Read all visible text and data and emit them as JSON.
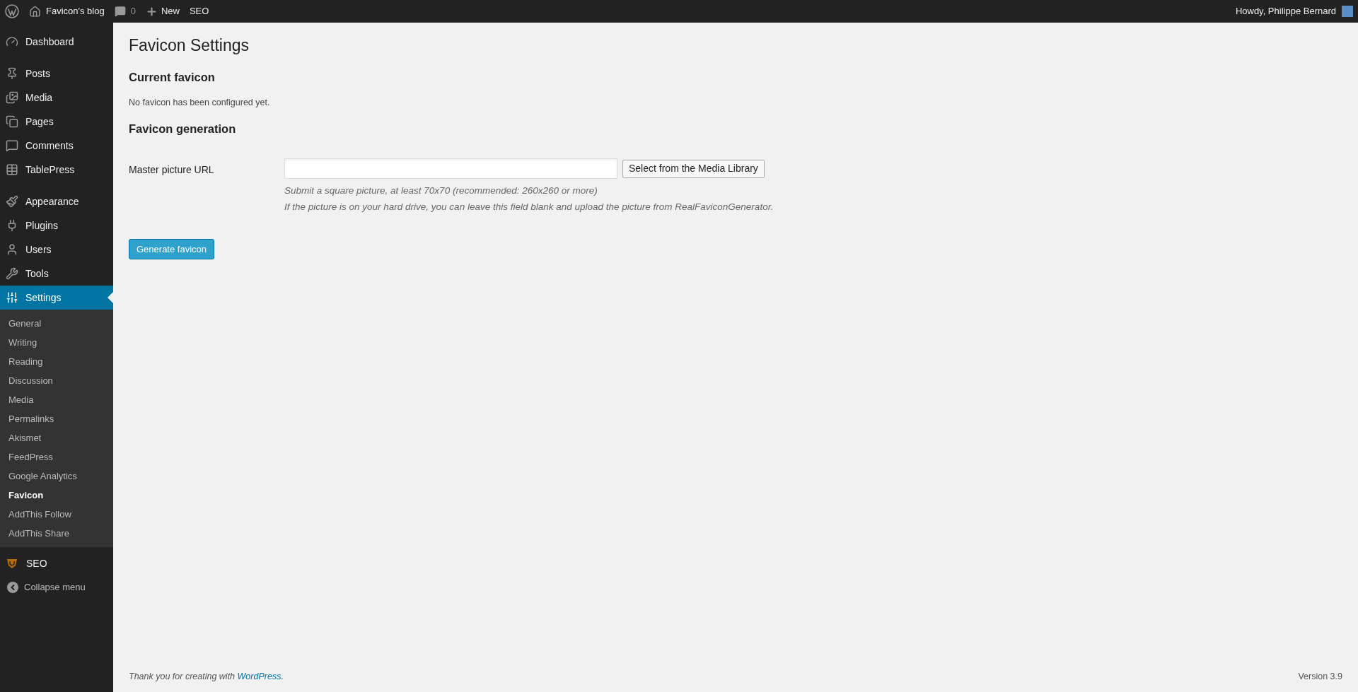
{
  "admin_bar": {
    "site": "Favicon's blog",
    "comments": "0",
    "new": "New",
    "seo": "SEO",
    "greeting": "Howdy, Philippe Bernard"
  },
  "sidebar": {
    "groups": [
      [
        {
          "label": "Dashboard",
          "selected": false
        }
      ],
      [
        {
          "label": "Posts",
          "selected": false
        },
        {
          "label": "Media",
          "selected": false
        },
        {
          "label": "Pages",
          "selected": false
        },
        {
          "label": "Comments",
          "selected": false
        },
        {
          "label": "TablePress",
          "selected": false
        }
      ],
      [
        {
          "label": "Appearance",
          "selected": false
        },
        {
          "label": "Plugins",
          "selected": false
        },
        {
          "label": "Users",
          "selected": false
        },
        {
          "label": "Tools",
          "selected": false
        },
        {
          "label": "Settings",
          "selected": true,
          "children": [
            {
              "label": "General",
              "selected": false
            },
            {
              "label": "Writing",
              "selected": false
            },
            {
              "label": "Reading",
              "selected": false
            },
            {
              "label": "Discussion",
              "selected": false
            },
            {
              "label": "Media",
              "selected": false
            },
            {
              "label": "Permalinks",
              "selected": false
            },
            {
              "label": "Akismet",
              "selected": false
            },
            {
              "label": "FeedPress",
              "selected": false
            },
            {
              "label": "Google Analytics",
              "selected": false
            },
            {
              "label": "Favicon",
              "selected": true
            },
            {
              "label": "AddThis Follow",
              "selected": false
            },
            {
              "label": "AddThis Share",
              "selected": false
            }
          ]
        }
      ]
    ],
    "seo": {
      "label": "SEO",
      "selected": false
    },
    "collapse": "Collapse menu"
  },
  "page": {
    "title": "Favicon Settings",
    "current_heading": "Current favicon",
    "current_text": "No favicon has been configured yet.",
    "generation_heading": "Favicon generation",
    "field_label": "Master picture URL",
    "media_button": "Select from the Media Library",
    "hints": [
      "Submit a square picture, at least 70x70 (recommended: 260x260 or more)",
      "If the picture is on your hard drive, you can leave this field blank and upload the picture from RealFaviconGenerator."
    ],
    "generate_button": "Generate favicon"
  },
  "footer": {
    "text": "Thank you for creating with",
    "link": "WordPress",
    "end": ".",
    "version": "Version 3.9"
  }
}
